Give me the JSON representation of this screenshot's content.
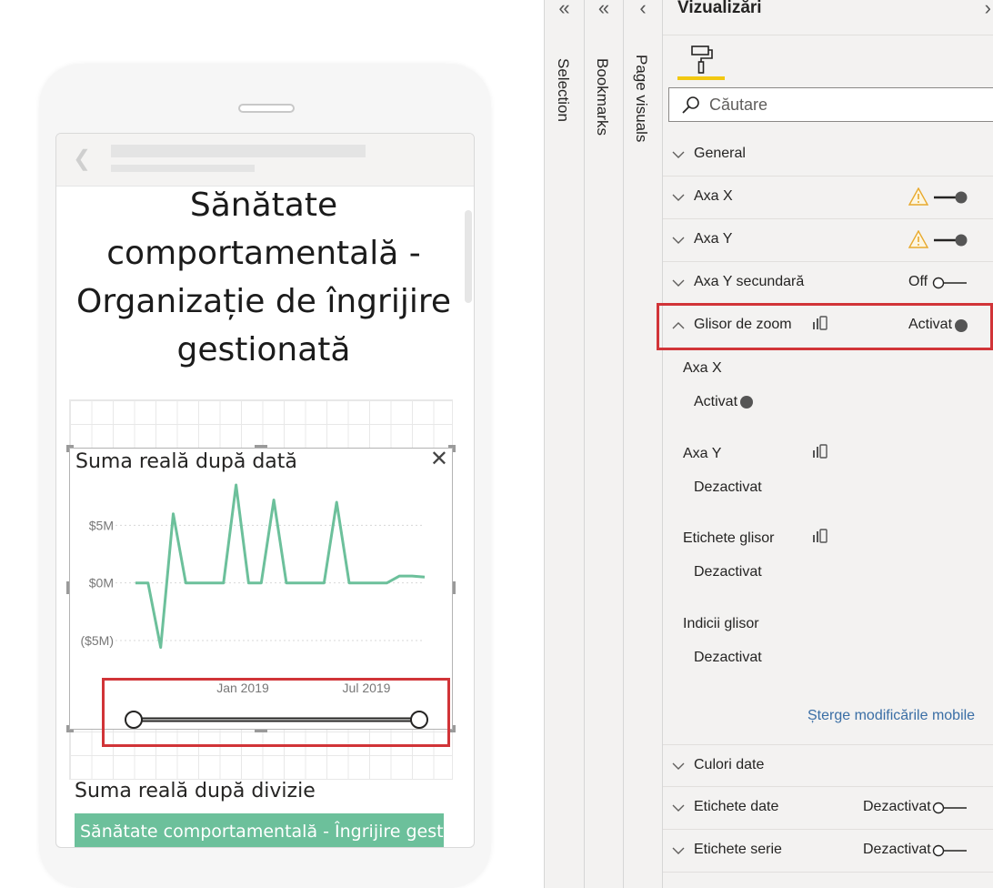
{
  "canvas": {
    "report_title": "Sănătate comportamentală - Organizație de îngrijire gestionată",
    "chart_card": {
      "title": "Suma reală după dată",
      "close_icon": "close-icon"
    },
    "division_title": "Suma reală după divizie",
    "division_bar_label": "Sănătate comportamentală - Îngrijire gest..."
  },
  "chart_data": {
    "type": "line",
    "title": "Suma reală după dată",
    "xlabel": "",
    "ylabel": "",
    "y_tick_labels": [
      "$5M",
      "$0M",
      "($5M)"
    ],
    "y_ticks": [
      5,
      0,
      -5
    ],
    "x_tick_labels": [
      "Jan 2019",
      "Jul 2019"
    ],
    "ylim": [
      -6.5,
      8.5
    ],
    "color": "#6cc09b",
    "series": [
      {
        "values": [
          0,
          0,
          -5.6,
          6,
          0,
          0,
          0,
          0,
          8.5,
          0,
          0,
          7.2,
          0,
          0,
          0,
          0,
          7.0,
          0,
          0,
          0,
          0,
          0.6,
          0.6,
          0.5
        ]
      }
    ],
    "zoom_slider": {
      "start": 0,
      "end": 1
    }
  },
  "panes": {
    "selection": {
      "label": "Selection",
      "icon": "double-chevron-left-icon"
    },
    "bookmarks": {
      "label": "Bookmarks",
      "icon": "double-chevron-left-icon"
    },
    "page_visuals": {
      "label": "Page visuals",
      "icon": "chevron-left-icon"
    }
  },
  "viz": {
    "title": "Vizualizări",
    "collapse_icon": "chevron-right-icon",
    "format_tab_icon": "paint-roller-icon",
    "search_placeholder": "Căutare",
    "accent": "#f2c811",
    "rows": [
      {
        "label": "General"
      },
      {
        "label": "Axa X",
        "warning": true,
        "state": ""
      },
      {
        "label": "Axa Y",
        "warning": true,
        "state": ""
      },
      {
        "label": "Axa Y secundară",
        "state": "Off"
      },
      {
        "label": "Glisor de zoom",
        "state": "Activat"
      }
    ],
    "zoom_settings": {
      "axa_x_label": "Axa X",
      "axa_x_value": "Activat",
      "axa_y_label": "Axa Y",
      "axa_y_value": "Dezactivat",
      "etichete_label": "Etichete glisor",
      "etichete_value": "Dezactivat",
      "indicii_label": "Indicii glisor",
      "indicii_value": "Dezactivat",
      "reset_link": "Șterge modificările mobile"
    },
    "bottom_rows": [
      {
        "label": "Culori date"
      },
      {
        "label": "Etichete date",
        "state": "Dezactivat"
      },
      {
        "label": "Etichete serie",
        "state": "Dezactivat"
      }
    ]
  }
}
